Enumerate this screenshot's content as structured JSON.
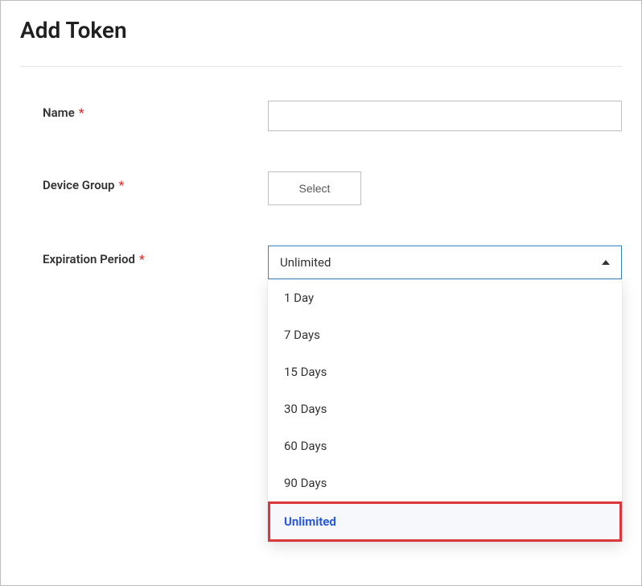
{
  "title": "Add Token",
  "form": {
    "name": {
      "label": "Name",
      "value": ""
    },
    "device_group": {
      "label": "Device Group",
      "button": "Select"
    },
    "expiration": {
      "label": "Expiration Period",
      "selected": "Unlimited",
      "options": [
        "1 Day",
        "7 Days",
        "15 Days",
        "30 Days",
        "60 Days",
        "90 Days",
        "Unlimited"
      ]
    }
  }
}
